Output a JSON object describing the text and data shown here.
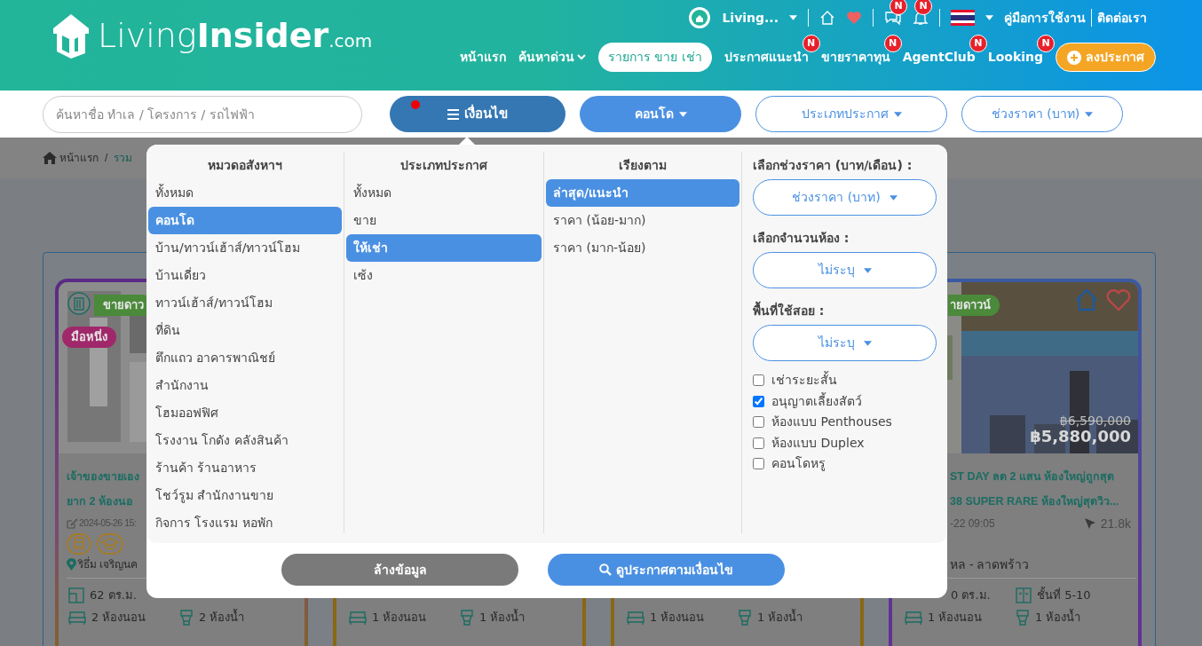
{
  "header": {
    "logo": {
      "light": "Living",
      "bold": "Insider",
      "suffix": ".com"
    },
    "account": {
      "name": "Living..."
    },
    "chat_badge": "N",
    "bell_badge": "N",
    "links": [
      "คู่มือการใช้งาน",
      "ติดต่อเรา"
    ],
    "nav": [
      {
        "label": "หน้าแรก",
        "kind": "link",
        "selected": false
      },
      {
        "label": "ค้นหาด่วน",
        "kind": "dropdown",
        "selected": false
      },
      {
        "label": "รายการ ขาย เช่า",
        "kind": "link",
        "selected": true
      },
      {
        "label": "ประกาศแนะนำ",
        "kind": "link",
        "badge": "N",
        "selected": false
      },
      {
        "label": "ขายราคาทุน",
        "kind": "link",
        "badge": "N",
        "selected": false
      },
      {
        "label": "AgentClub",
        "kind": "link",
        "badge": "N",
        "selected": false
      },
      {
        "label": "Looking",
        "kind": "link",
        "badge": "N",
        "selected": false
      }
    ],
    "post_button": "ลงประกาศ"
  },
  "filter_bar": {
    "search": {
      "placeholder": "ค้นหาชื่อ ทำเล / โครงการ / รถไฟฟ้า"
    },
    "buttons": [
      {
        "label": "เงื่อนไข",
        "kind": "conditions",
        "expanded": true,
        "notice": true
      },
      {
        "label": "คอนโด",
        "kind": "filled"
      },
      {
        "label": "ประเภทประกาศ",
        "kind": "outline"
      },
      {
        "label": "ช่วงราคา (บาท)",
        "kind": "outline"
      }
    ]
  },
  "breadcrumb": {
    "items": [
      "หน้าแรก",
      "รวม"
    ],
    "separator": "/"
  },
  "filter_panel": {
    "columns": [
      {
        "title": "หมวดอสังหาฯ",
        "items": [
          {
            "label": "ทั้งหมด",
            "selected": false
          },
          {
            "label": "คอนโด",
            "selected": true
          },
          {
            "label": "บ้าน/ทาวน์เฮ้าส์/ทาวน์โฮม",
            "selected": false
          },
          {
            "label": "บ้านเดี่ยว",
            "selected": false
          },
          {
            "label": "ทาวน์เฮ้าส์/ทาวน์โฮม",
            "selected": false
          },
          {
            "label": "ที่ดิน",
            "selected": false
          },
          {
            "label": "ตึกแถว อาคารพาณิชย์",
            "selected": false
          },
          {
            "label": "สำนักงาน",
            "selected": false
          },
          {
            "label": "โฮมออฟฟิศ",
            "selected": false
          },
          {
            "label": "โรงงาน โกดัง คลังสินค้า",
            "selected": false
          },
          {
            "label": "ร้านค้า ร้านอาหาร",
            "selected": false
          },
          {
            "label": "โชว์รูม สำนักงานขาย",
            "selected": false
          },
          {
            "label": "กิจการ โรงแรม หอพัก",
            "selected": false
          }
        ]
      },
      {
        "title": "ประเภทประกาศ",
        "items": [
          {
            "label": "ทั้งหมด",
            "selected": false
          },
          {
            "label": "ขาย",
            "selected": false
          },
          {
            "label": "ให้เช่า",
            "selected": true
          },
          {
            "label": "เซ้ง",
            "selected": false
          }
        ]
      },
      {
        "title": "เรียงตาม",
        "items": [
          {
            "label": "ล่าสุด/แนะนำ",
            "selected": true
          },
          {
            "label": "ราคา (น้อย-มาก)",
            "selected": false
          },
          {
            "label": "ราคา (มาก-น้อย)",
            "selected": false
          }
        ]
      }
    ],
    "fields": [
      {
        "label": "เลือกช่วงราคา (บาท/เดือน) :",
        "value": "ช่วงราคา (บาท)"
      },
      {
        "label": "เลือกจำนวนห้อง :",
        "value": "ไม่ระบุ"
      },
      {
        "label": "พื้นที่ใช้สอย :",
        "value": "ไม่ระบุ"
      }
    ],
    "checkboxes": [
      {
        "label": "เช่าระยะสั้น",
        "checked": false
      },
      {
        "label": "อนุญาตเลี้ยงสัตว์",
        "checked": true
      },
      {
        "label": "ห้องแบบ Penthouses",
        "checked": false
      },
      {
        "label": "ห้องแบบ Duplex",
        "checked": false
      },
      {
        "label": "คอนโดหรู",
        "checked": false
      }
    ],
    "clear_button": "ล้างข้อมูล",
    "search_button": "ดูประกาศตามเงื่อนไข"
  },
  "listings": [
    {
      "badges": [
        {
          "label": "ขายดาว",
          "kind": "sale"
        },
        {
          "label": "มือหนึ่ง",
          "kind": "first-hand"
        }
      ],
      "title_lines": [
        "เจ้าของขายเอง",
        "ยาก 2 ห้องนอ"
      ],
      "date": "2024-05-26 15:",
      "location": "ริธึ่ม เจริญนค",
      "area": "62 ตร.ม.",
      "bedrooms": "2 ห้องนอน",
      "bathrooms": "2 ห้องน้ำ"
    },
    {
      "bedrooms": "1 ห้องนอน",
      "bathrooms": "1 ห้องน้ำ"
    },
    {
      "bedrooms": "1 ห้องนอน",
      "bathrooms": "1 ห้องน้ำ"
    },
    {
      "badges": [
        {
          "label": "ายดาวน์",
          "kind": "sale"
        }
      ],
      "favorite": true,
      "old_price": "฿6,590,000",
      "price": "฿5,880,000",
      "title_lines": [
        "ST DAY ลด 2 แสน ห้องใหญ่ถูกสุด",
        "38 SUPER RARE ห้องใหญ่สุดวิว..."
      ],
      "date": "-22 09:05",
      "views": "21.8k",
      "location": "หล - ลาดพร้าว",
      "area": "0 ตร.ม.",
      "floor": "ชั้นที่ 5-10",
      "bedrooms": "1 ห้องนอน",
      "bathrooms": "1 ห้องน้ำ"
    }
  ]
}
